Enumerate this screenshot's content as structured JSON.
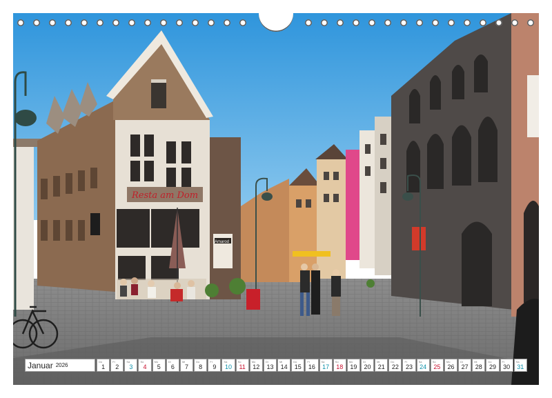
{
  "calendar": {
    "month": "Januar",
    "year": "2026",
    "days": [
      {
        "n": "1",
        "w": "Do",
        "t": "we"
      },
      {
        "n": "2",
        "w": "Fr",
        "t": "we"
      },
      {
        "n": "3",
        "w": "Sa",
        "t": "sat"
      },
      {
        "n": "4",
        "w": "So",
        "t": "sun"
      },
      {
        "n": "5",
        "w": "Mo",
        "t": "we"
      },
      {
        "n": "6",
        "w": "Di",
        "t": "we"
      },
      {
        "n": "7",
        "w": "Mi",
        "t": "we"
      },
      {
        "n": "8",
        "w": "Do",
        "t": "we"
      },
      {
        "n": "9",
        "w": "Fr",
        "t": "we"
      },
      {
        "n": "10",
        "w": "Sa",
        "t": "sat"
      },
      {
        "n": "11",
        "w": "So",
        "t": "sun"
      },
      {
        "n": "12",
        "w": "Mo",
        "t": "we"
      },
      {
        "n": "13",
        "w": "Di",
        "t": "we"
      },
      {
        "n": "14",
        "w": "Mi",
        "t": "we"
      },
      {
        "n": "15",
        "w": "Do",
        "t": "we"
      },
      {
        "n": "16",
        "w": "Fr",
        "t": "we"
      },
      {
        "n": "17",
        "w": "Sa",
        "t": "sat"
      },
      {
        "n": "18",
        "w": "So",
        "t": "sun"
      },
      {
        "n": "19",
        "w": "Mo",
        "t": "we"
      },
      {
        "n": "20",
        "w": "Di",
        "t": "we"
      },
      {
        "n": "21",
        "w": "Mi",
        "t": "we"
      },
      {
        "n": "22",
        "w": "Do",
        "t": "we"
      },
      {
        "n": "23",
        "w": "Fr",
        "t": "we"
      },
      {
        "n": "24",
        "w": "Sa",
        "t": "sat"
      },
      {
        "n": "25",
        "w": "So",
        "t": "sun"
      },
      {
        "n": "26",
        "w": "Mo",
        "t": "we"
      },
      {
        "n": "27",
        "w": "Di",
        "t": "we"
      },
      {
        "n": "28",
        "w": "Mi",
        "t": "we"
      },
      {
        "n": "29",
        "w": "Do",
        "t": "we"
      },
      {
        "n": "30",
        "w": "Fr",
        "t": "we"
      },
      {
        "n": "31",
        "w": "Sa",
        "t": "sat"
      }
    ]
  },
  "photo": {
    "sign_restaurant": "Resta   am   Dom",
    "sign_shop": "Amarod"
  },
  "colors": {
    "sky": "#3ea3e4",
    "saturday": "#0a8fa8",
    "sunday": "#c8102e"
  }
}
